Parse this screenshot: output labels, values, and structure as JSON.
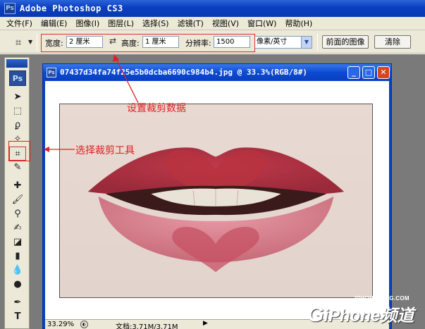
{
  "app": {
    "title": "Adobe Photoshop CS3",
    "badge": "Ps"
  },
  "menu": [
    "文件(F)",
    "编辑(E)",
    "图像(I)",
    "图层(L)",
    "选择(S)",
    "滤镜(T)",
    "视图(V)",
    "窗口(W)",
    "帮助(H)"
  ],
  "options": {
    "width_label": "宽度:",
    "width_value": "2 厘米",
    "height_label": "高度:",
    "height_value": "1 厘米",
    "resolution_label": "分辨率:",
    "resolution_value": "1500",
    "unit_value": "像素/英寸",
    "front_image_button": "前面的图像",
    "clear_button": "清除"
  },
  "toolbox": {
    "logo": "Ps",
    "tools": [
      "move-tool",
      "marquee-tool",
      "lasso-tool",
      "magic-wand-tool",
      "crop-tool",
      "slice-tool",
      "healing-brush-tool",
      "brush-tool",
      "clone-stamp-tool",
      "history-brush-tool",
      "eraser-tool",
      "gradient-tool",
      "blur-tool",
      "dodge-tool",
      "pen-tool",
      "type-tool"
    ]
  },
  "document": {
    "title": "07437d34fa74f25e5b0dcba6690c984b4.jpg @ 33.3%(RGB/8#)",
    "zoom": "33.29%",
    "doc_info": "文档:3.71M/3.71M"
  },
  "annotations": {
    "set_crop_data": "设置裁剪数据",
    "select_crop_tool": "选择裁剪工具"
  },
  "watermark": {
    "url": "IPHONE.265G.COM",
    "logo_prefix": "G",
    "logo_text": "iPhone频道"
  },
  "colors": {
    "title_bar": "#0a3fbf",
    "annotation_red": "#e02020",
    "menu_bg": "#ece9d8"
  }
}
